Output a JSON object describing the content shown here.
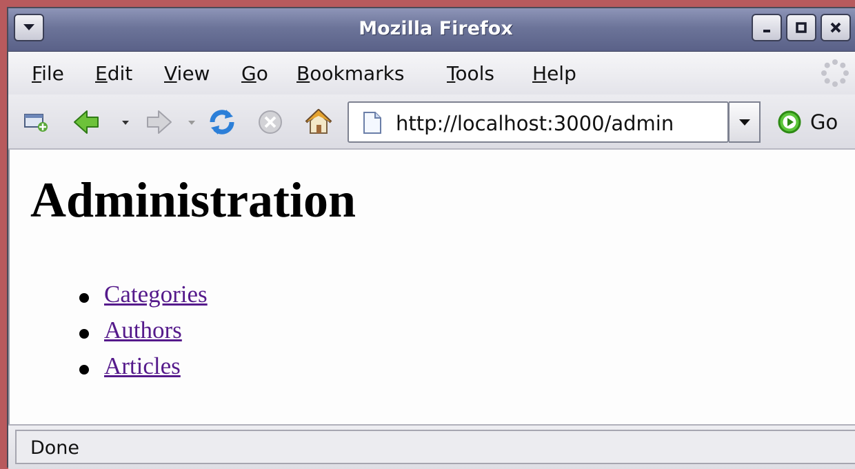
{
  "window": {
    "title": "Mozilla Firefox"
  },
  "menubar": {
    "items": [
      {
        "mnemonic": "F",
        "rest": "ile"
      },
      {
        "mnemonic": "E",
        "rest": "dit"
      },
      {
        "mnemonic": "V",
        "rest": "iew"
      },
      {
        "mnemonic": "G",
        "rest": "o"
      },
      {
        "mnemonic": "B",
        "rest": "ookmarks"
      },
      {
        "mnemonic": "T",
        "rest": "ools"
      },
      {
        "mnemonic": "H",
        "rest": "elp"
      }
    ]
  },
  "toolbar": {
    "url": "http://localhost:3000/admin",
    "go_label": "Go"
  },
  "page": {
    "heading": "Administration",
    "links": [
      "Categories",
      "Authors",
      "Articles"
    ]
  },
  "status": {
    "text": "Done"
  },
  "colors": {
    "link_visited": "#551a8b",
    "desktop": "#b85a5d",
    "titlebar": "#6c7499"
  },
  "icons": [
    "window-menu-icon",
    "minimize-icon",
    "maximize-icon",
    "close-icon",
    "throbber-icon",
    "new-window-icon",
    "back-icon",
    "forward-icon",
    "reload-icon",
    "stop-icon",
    "home-icon",
    "page-icon",
    "dropdown-arrow-icon",
    "go-icon"
  ]
}
